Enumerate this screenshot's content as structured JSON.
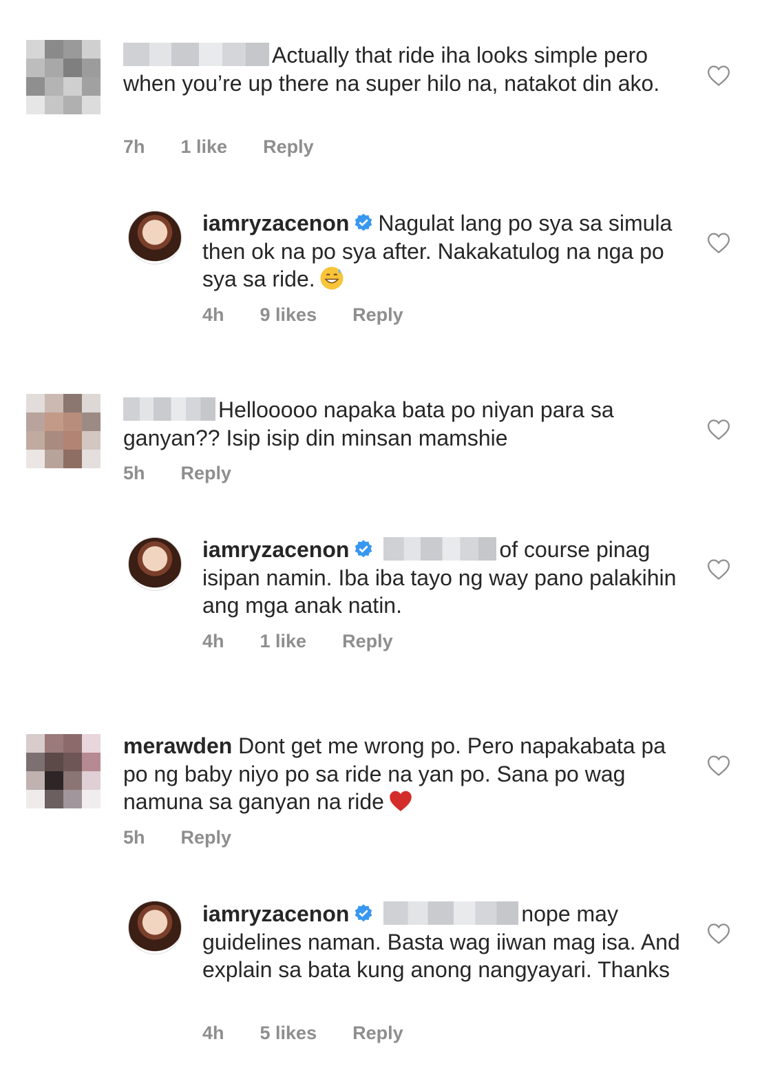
{
  "comments": [
    {
      "username": "",
      "text": "Actually that ride iha looks simple pero when you’re up there na super hilo na, natakot din ako.",
      "time": "7h",
      "likes": "1 like",
      "reply": "Reply"
    },
    {
      "username": "iamryzacenon",
      "text": "Nagulat lang po sya sa simula then ok na po sya after. Nakakatulog na nga po sya sa ride.",
      "time": "4h",
      "likes": "9 likes",
      "reply": "Reply"
    },
    {
      "username": "",
      "text": "Hellooooo napaka bata po niyan para sa ganyan?? Isip isip din minsan mamshie",
      "time": "5h",
      "reply": "Reply"
    },
    {
      "username": "iamryzacenon",
      "text": "of course pinag isipan namin. Iba iba tayo ng way pano palakihin ang mga anak natin.",
      "time": "4h",
      "likes": "1 like",
      "reply": "Reply"
    },
    {
      "username": "merawden",
      "text": "Dont get me wrong po. Pero napakabata pa po ng baby niyo po sa ride na yan po. Sana po wag namuna sa ganyan na ride",
      "time": "5h",
      "reply": "Reply"
    },
    {
      "username": "iamryzacenon",
      "text": "nope may guidelines naman. Basta wag iiwan mag isa. And explain sa bata kung anong nangyayari. Thanks",
      "time": "4h",
      "likes": "5 likes",
      "reply": "Reply"
    }
  ],
  "icons": {
    "like": "heart-outline-icon",
    "verified": "verified-badge-icon",
    "emoji_sweat": "grinning-sweat-emoji",
    "emoji_heart": "red-heart-emoji"
  },
  "colors": {
    "text": "#262626",
    "meta": "#8e8e8e",
    "verified": "#3897f0",
    "heart": "#d42b2b"
  }
}
